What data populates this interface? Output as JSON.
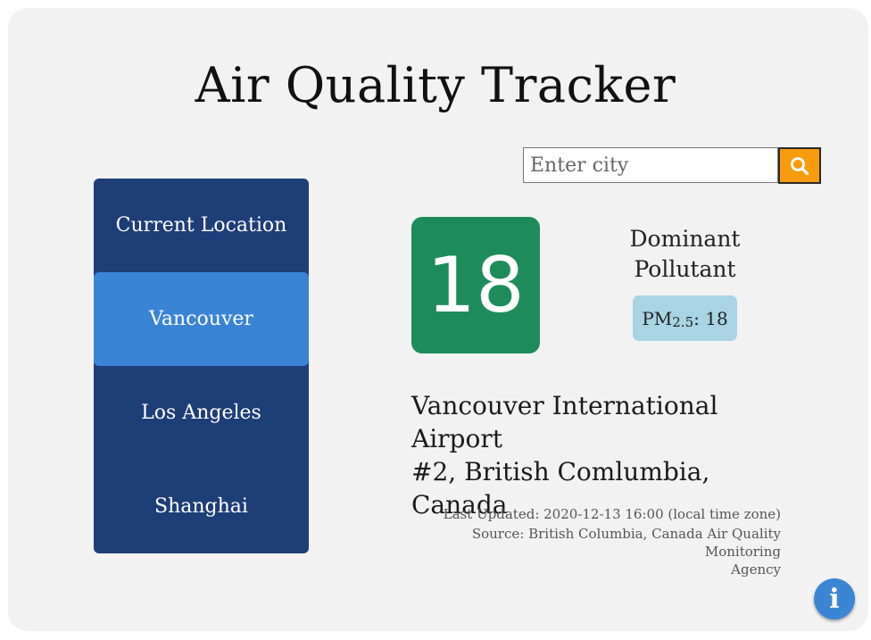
{
  "app": {
    "title": "Air Quality Tracker"
  },
  "search": {
    "placeholder": "Enter city",
    "value": "",
    "button_icon": "search-icon",
    "button_color": "#f79c0e"
  },
  "sidebar": {
    "items": [
      {
        "label": "Current Location",
        "active": false
      },
      {
        "label": "Vancouver",
        "active": true
      },
      {
        "label": "Los Angeles",
        "active": false
      },
      {
        "label": "Shanghai",
        "active": false
      }
    ],
    "background": "#1e3e78",
    "active_color": "#3a84d6"
  },
  "aqi": {
    "value": "18",
    "color": "#1e8c5a"
  },
  "dominant": {
    "heading_line1": "Dominant",
    "heading_line2": "Pollutant",
    "pollutant_name": "PM",
    "pollutant_sub": "2.5",
    "pollutant_value": ": 18"
  },
  "station": {
    "line1": "Vancouver International Airport",
    "line2": "#2, British Comlumbia, Canada"
  },
  "meta": {
    "last_updated": "Last Updated: 2020-12-13 16:00 (local time zone)",
    "source_line1": "Source: British Columbia, Canada Air Quality Monitoring",
    "source_line2": "Agency"
  },
  "info": {
    "icon": "info-icon",
    "glyph": "i"
  }
}
